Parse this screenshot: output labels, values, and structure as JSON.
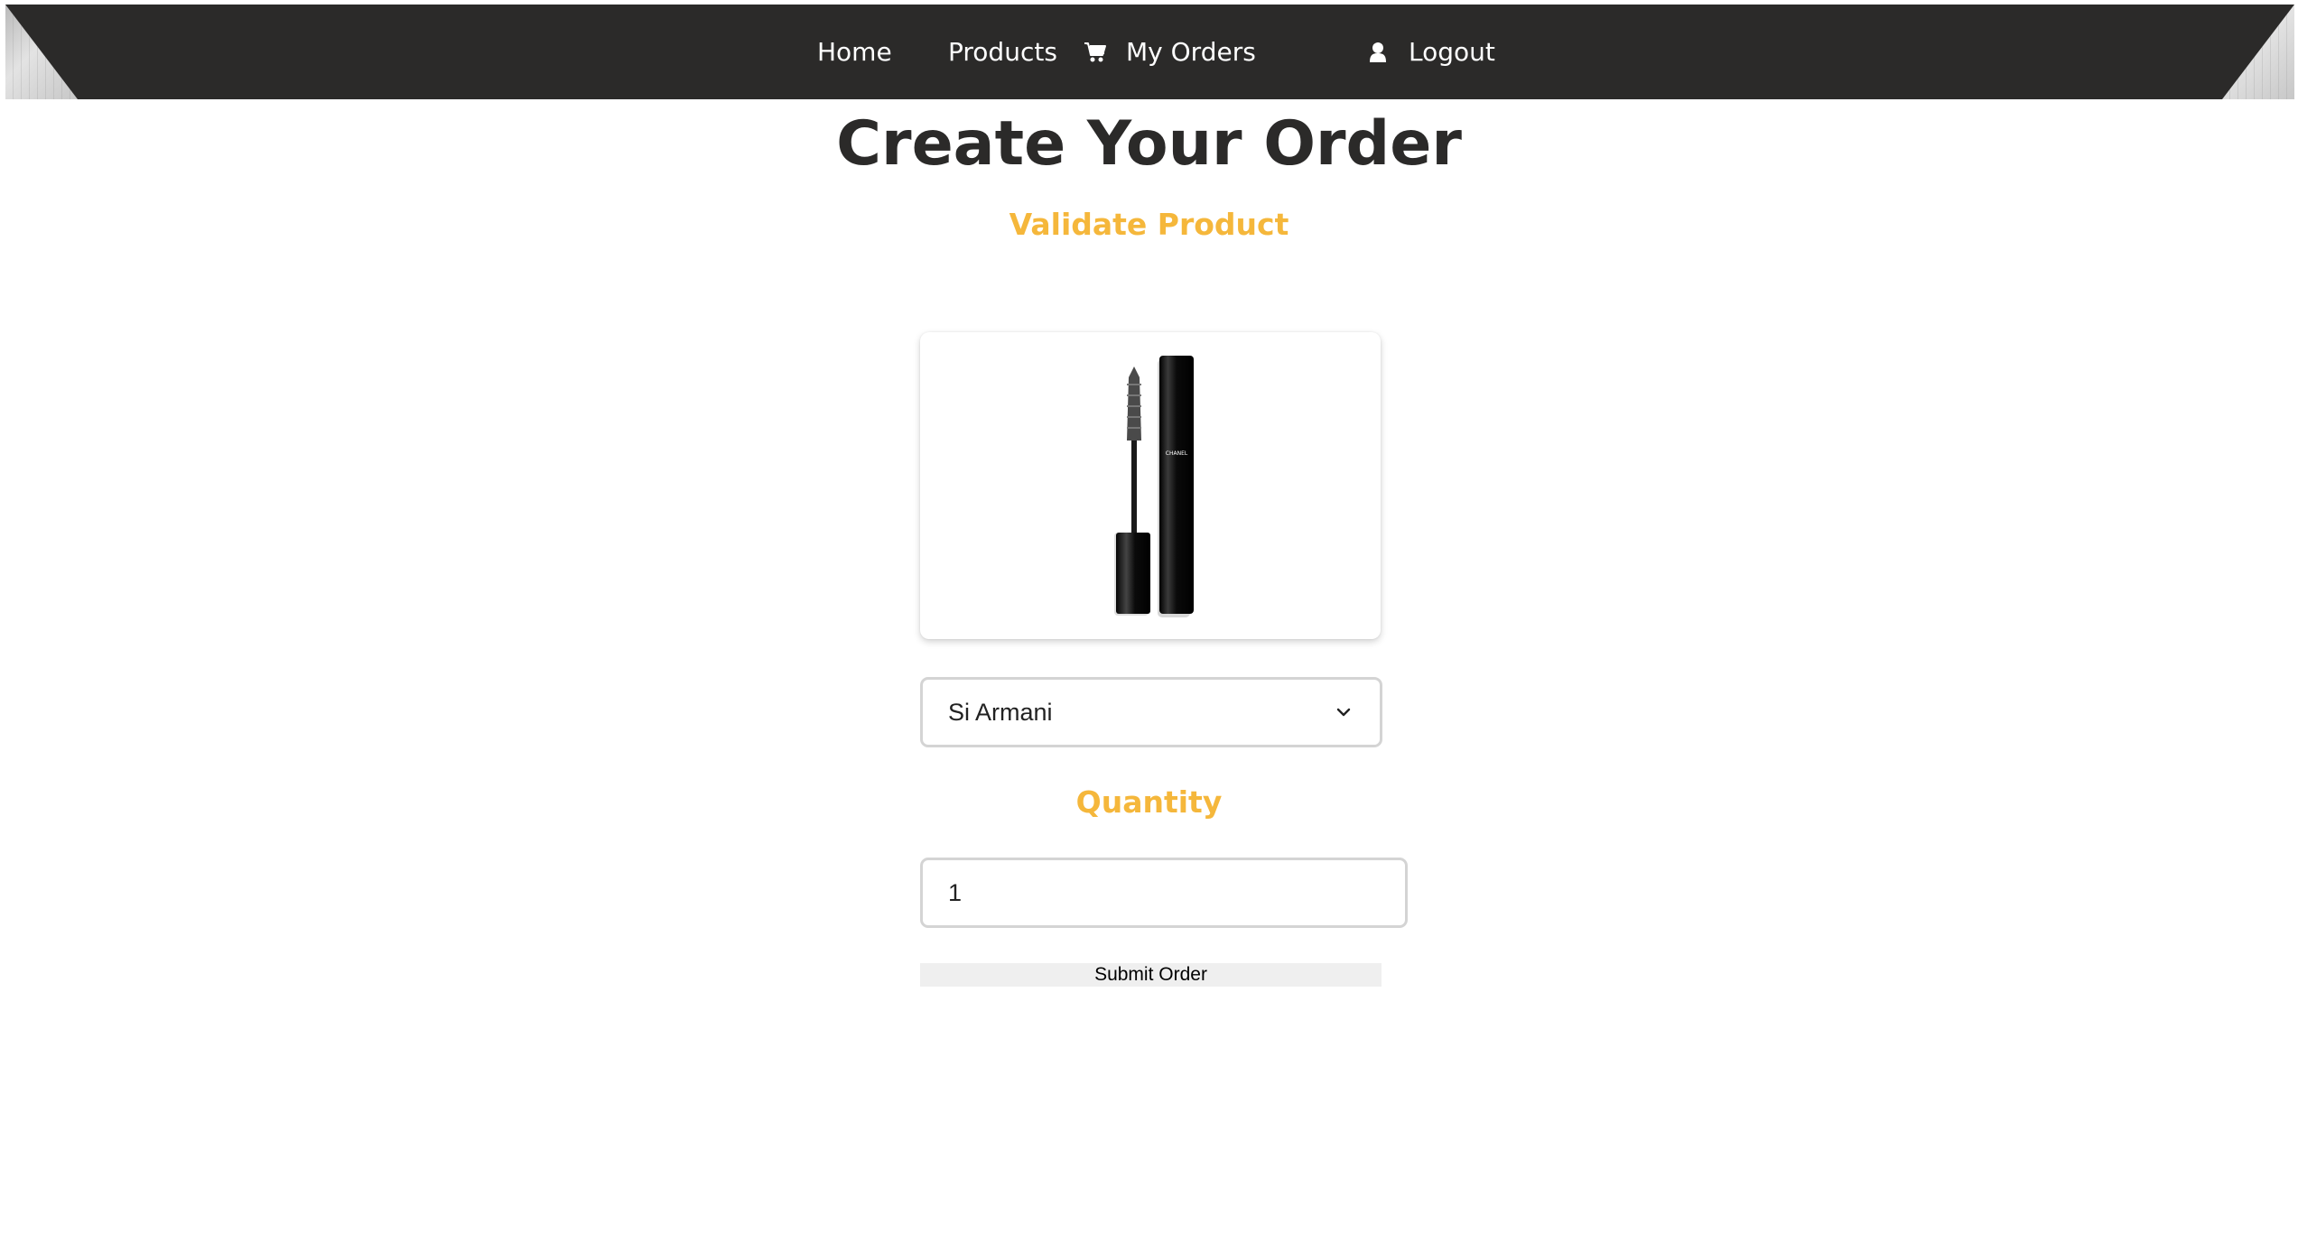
{
  "nav": {
    "home_label": "Home",
    "products_label": "Products",
    "orders_label": "My Orders",
    "orders_icon": "cart-icon",
    "logout_label": "Logout",
    "logout_icon": "user-icon",
    "background_color": "#2b2a29"
  },
  "header": {
    "title": "Create Your Order",
    "validate_label": "Validate Product",
    "accent_color": "#f5b73b"
  },
  "product": {
    "image_alt": "mascara product image",
    "brand_text": "CHANEL"
  },
  "product_select": {
    "selected": "Si Armani",
    "icon": "chevron-down-icon"
  },
  "quantity": {
    "label": "Quantity",
    "value": "1"
  },
  "submit": {
    "label": "Submit Order"
  }
}
